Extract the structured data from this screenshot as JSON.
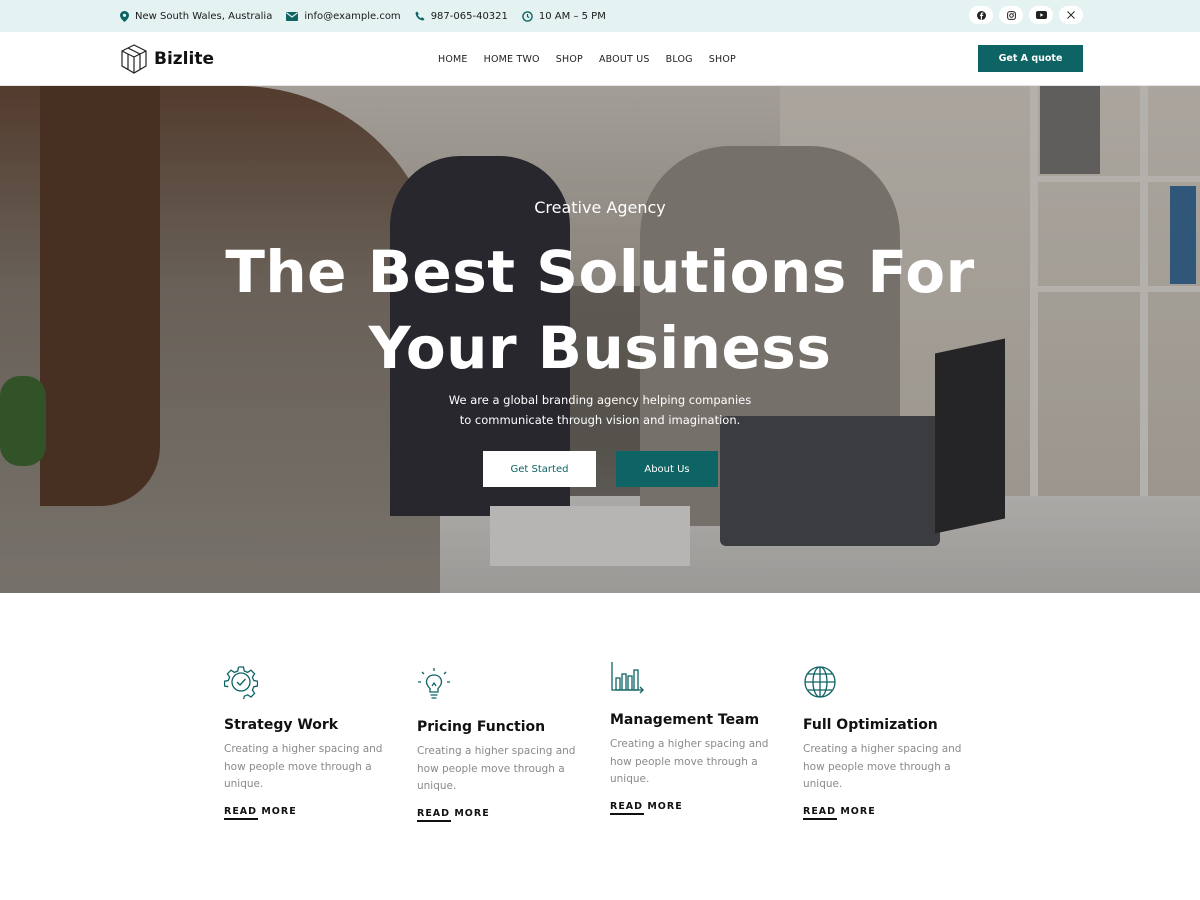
{
  "topbar": {
    "location": "New South Wales, Australia",
    "email": "info@example.com",
    "phone": "987-065-40321",
    "hours": "10 AM – 5 PM",
    "socials": [
      "facebook-icon",
      "instagram-icon",
      "youtube-icon",
      "x-icon"
    ]
  },
  "header": {
    "logo_text": "Bizlite",
    "nav": [
      "HOME",
      "HOME TWO",
      "SHOP",
      "ABOUT US",
      "BLOG",
      "SHOP"
    ],
    "cta": "Get A quote"
  },
  "hero": {
    "eyebrow": "Creative Agency",
    "title_line1": "The Best Solutions For",
    "title_line2": "Your Business",
    "desc_line1": "We are a global branding agency helping companies",
    "desc_line2": "to communicate through vision and imagination.",
    "primary_button": "Get Started",
    "secondary_button": "About Us"
  },
  "features": [
    {
      "icon": "gear-check-icon",
      "title": "Strategy Work",
      "desc": "Creating a higher spacing and how people move through a unique.",
      "link": "READ MORE"
    },
    {
      "icon": "lightbulb-icon",
      "title": "Pricing Function",
      "desc": "Creating a higher spacing and how people move through a unique.",
      "link": "READ MORE"
    },
    {
      "icon": "bar-chart-icon",
      "title": "Management Team",
      "desc": "Creating a higher spacing and how people move through a unique.",
      "link": "READ MORE"
    },
    {
      "icon": "globe-icon",
      "title": "Full Optimization",
      "desc": "Creating a higher spacing and how people move through a unique.",
      "link": "READ MORE"
    }
  ],
  "colors": {
    "accent": "#0e6364",
    "topbar_bg": "#e4f2f2",
    "text_muted": "#8a8a8a"
  }
}
